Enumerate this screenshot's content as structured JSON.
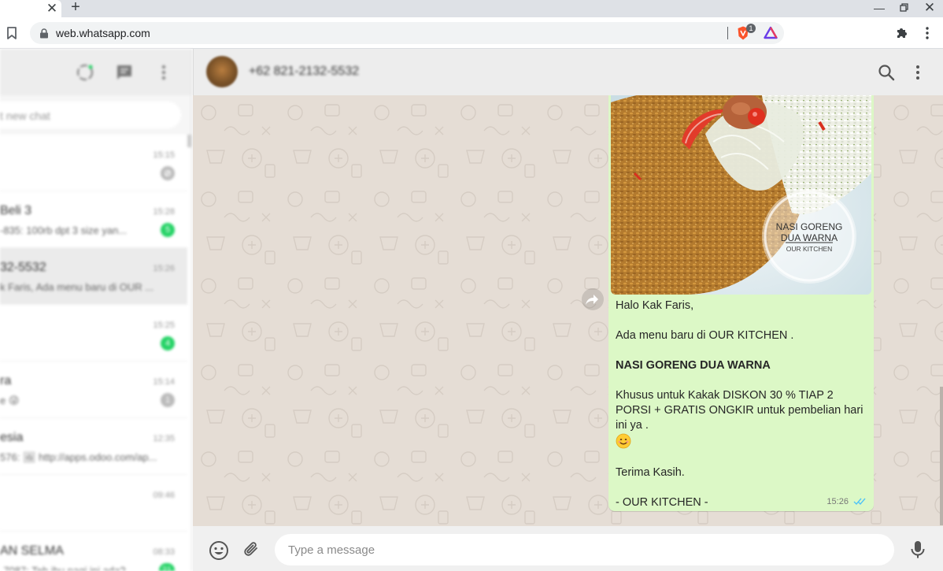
{
  "browser": {
    "url": "web.whatsapp.com",
    "brave_shield_count": "1"
  },
  "left_panel": {
    "search_placeholder": "t new chat",
    "chats": [
      {
        "name": "",
        "time": "15:15",
        "preview": "",
        "badge": "",
        "muted_icon": true
      },
      {
        "name": "Beli 3",
        "time": "15:28",
        "preview": "-835: 100rb dpt 3 size yan...",
        "badge": "5"
      },
      {
        "name": "32-5532",
        "time": "15:26",
        "preview": "k Faris, Ada menu baru di OUR ...",
        "badge": "",
        "active": true
      },
      {
        "name": "",
        "time": "15:25",
        "preview": "",
        "badge": "4"
      },
      {
        "name": "ra",
        "time": "15:14",
        "preview": "e 😜",
        "badge": "1",
        "badge_grey": true
      },
      {
        "name": "esia",
        "time": "12:35",
        "preview": "576: 🖼 http://apps.odoo.com/ap...",
        "badge": ""
      },
      {
        "name": "",
        "time": "09:46",
        "preview": "",
        "badge": ""
      },
      {
        "name": "AN SELMA",
        "time": "08:33",
        "preview": "-7087: Teh ibu pagi ini ada?",
        "badge": "21"
      }
    ]
  },
  "chat": {
    "contact_name": "+62 821-2132-5532",
    "message": {
      "image_caption": {
        "line1": "NASI GORENG",
        "line2": "DUA WARNA",
        "line3": "OUR KITCHEN"
      },
      "greeting": "Halo Kak Faris,",
      "intro": "Ada menu baru di OUR KITCHEN .",
      "title": "NASI GORENG DUA WARNA",
      "promo": "Khusus untuk Kakak DISKON 30 % TIAP 2 PORSI + GRATIS ONGKIR untuk pembelian hari ini ya .",
      "thanks": "Terima Kasih.",
      "signature": "- OUR KITCHEN -",
      "time": "15:26",
      "status": "read"
    }
  },
  "composer": {
    "placeholder": "Type a message"
  },
  "colors": {
    "chat_background": "#e5ddd5",
    "outgoing_bubble": "#dcf8c6",
    "read_ticks": "#4fc3f7",
    "unread_badge": "#25d366"
  }
}
